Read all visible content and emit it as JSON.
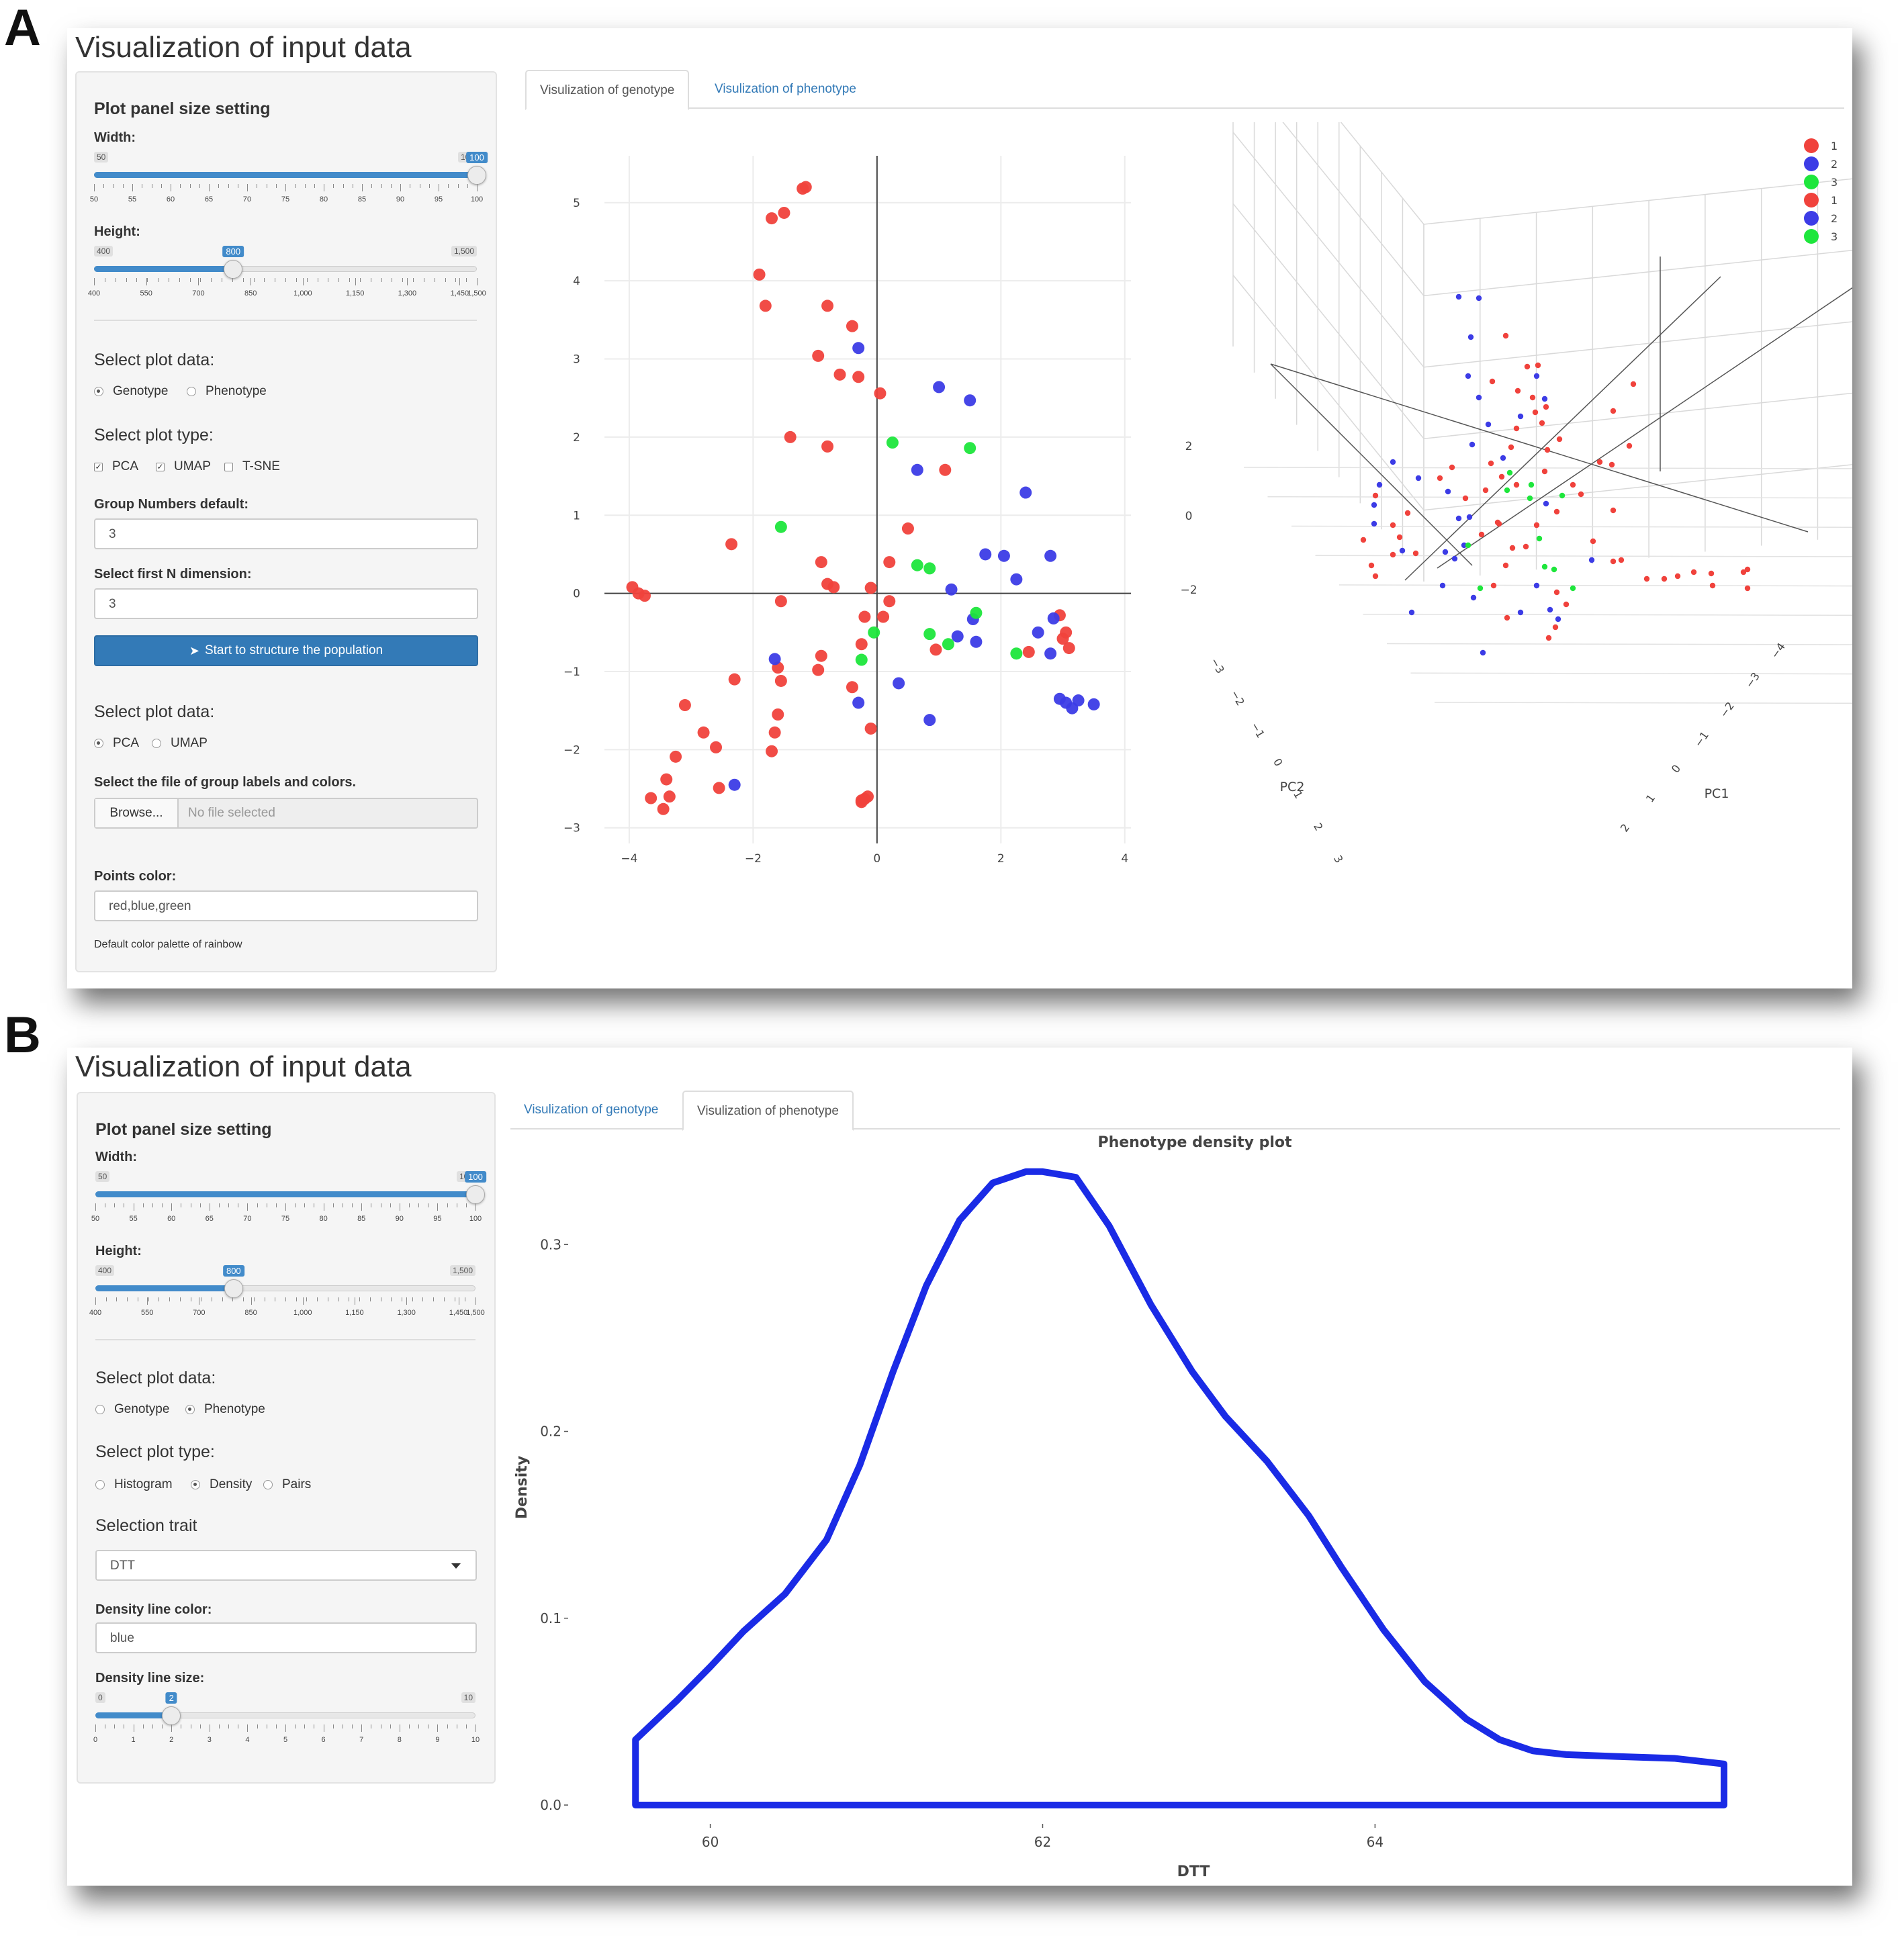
{
  "panel_labels": [
    "A",
    "B"
  ],
  "panel_a": {
    "app_title": "Visualization of input data",
    "sidebar": {
      "section_title": "Plot panel size setting",
      "width_label": "Width:",
      "width_slider": {
        "min": 50,
        "max": 100,
        "value": 100,
        "min_label": "50",
        "max_label": "100",
        "value_label": "100",
        "ticks": [
          "50",
          "55",
          "60",
          "65",
          "70",
          "75",
          "80",
          "85",
          "90",
          "95",
          "100"
        ]
      },
      "height_label": "Height:",
      "height_slider": {
        "min": 400,
        "max": 1500,
        "value": 800,
        "min_label": "400",
        "max_label": "1,500",
        "value_label": "800",
        "ticks": [
          "400",
          "550",
          "700",
          "850",
          "1,000",
          "1,150",
          "1,300",
          "1,450",
          "1,500"
        ]
      },
      "select_plot_data_title": "Select plot data:",
      "plot_data_options": [
        {
          "label": "Genotype",
          "selected": true
        },
        {
          "label": "Phenotype",
          "selected": false
        }
      ],
      "select_plot_type_title": "Select plot type:",
      "plot_type_options": [
        {
          "label": "PCA",
          "checked": true
        },
        {
          "label": "UMAP",
          "checked": true
        },
        {
          "label": "T-SNE",
          "checked": false
        }
      ],
      "group_numbers_label": "Group Numbers default:",
      "group_numbers_value": "3",
      "first_n_dim_label": "Select first N dimension:",
      "first_n_dim_value": "3",
      "start_button_label": "Start to structure the population",
      "select_plot_data_title_2": "Select plot data:",
      "plot_data_options_2": [
        {
          "label": "PCA",
          "selected": true
        },
        {
          "label": "UMAP",
          "selected": false
        }
      ],
      "group_file_label": "Select the file of group labels and colors.",
      "browse_label": "Browse...",
      "file_placeholder": "No file selected",
      "points_color_label": "Points color:",
      "points_color_value": "red,blue,green",
      "palette_note": "Default color palette of rainbow"
    },
    "tabs": [
      {
        "label": "Visulization of genotype",
        "active": true
      },
      {
        "label": "Visulization of phenotype",
        "active": false
      }
    ],
    "legend": {
      "entries": [
        "1",
        "2",
        "3",
        "1",
        "2",
        "3"
      ],
      "colors": [
        "#f0423c",
        "#3c3ce6",
        "#1ee63c",
        "#f0423c",
        "#3c3ce6",
        "#1ee63c"
      ]
    },
    "colors": {
      "group1": "#f0423c",
      "group2": "#3c3ce6",
      "group3": "#1ee63c"
    },
    "chart_data": [
      {
        "type": "scatter",
        "title": "",
        "xlabel": "",
        "ylabel": "",
        "xlim": [
          -4.4,
          4.1
        ],
        "ylim": [
          -3.2,
          5.6
        ],
        "xticks": [
          -4,
          -2,
          0,
          2,
          4
        ],
        "yticks": [
          -3,
          -2,
          -1,
          0,
          1,
          2,
          3,
          4,
          5
        ],
        "grid": true,
        "series": [
          {
            "name": "1",
            "color": "#f0423c",
            "points": [
              [
                -1.15,
                5.2
              ],
              [
                -1.2,
                5.18
              ],
              [
                -1.5,
                4.87
              ],
              [
                -1.7,
                4.8
              ],
              [
                -1.9,
                4.08
              ],
              [
                -1.8,
                3.68
              ],
              [
                -0.8,
                3.68
              ],
              [
                -0.4,
                3.42
              ],
              [
                -0.95,
                3.04
              ],
              [
                -0.6,
                2.8
              ],
              [
                -0.3,
                2.77
              ],
              [
                0.05,
                2.56
              ],
              [
                -1.4,
                2.0
              ],
              [
                -0.8,
                1.88
              ],
              [
                1.1,
                1.58
              ],
              [
                0.5,
                0.83
              ],
              [
                -2.35,
                0.63
              ],
              [
                -0.9,
                0.4
              ],
              [
                -0.8,
                0.12
              ],
              [
                -0.7,
                0.08
              ],
              [
                -0.1,
                0.07
              ],
              [
                0.2,
                0.4
              ],
              [
                0.2,
                -0.1
              ],
              [
                -3.95,
                0.08
              ],
              [
                -3.85,
                0.0
              ],
              [
                -3.75,
                -0.03
              ],
              [
                -1.55,
                -0.1
              ],
              [
                -0.2,
                -0.3
              ],
              [
                0.1,
                -0.3
              ],
              [
                -0.25,
                -0.65
              ],
              [
                -0.9,
                -0.8
              ],
              [
                -0.95,
                -0.98
              ],
              [
                -1.6,
                -0.95
              ],
              [
                -1.55,
                -1.12
              ],
              [
                -0.4,
                -1.2
              ],
              [
                -2.3,
                -1.1
              ],
              [
                -3.1,
                -1.43
              ],
              [
                -1.6,
                -1.55
              ],
              [
                -0.1,
                -1.73
              ],
              [
                -2.8,
                -1.78
              ],
              [
                -1.65,
                -1.78
              ],
              [
                -2.6,
                -1.97
              ],
              [
                -1.7,
                -2.02
              ],
              [
                -3.25,
                -2.09
              ],
              [
                -2.55,
                -2.49
              ],
              [
                -3.4,
                -2.38
              ],
              [
                -3.65,
                -2.62
              ],
              [
                -3.35,
                -2.6
              ],
              [
                -3.45,
                -2.76
              ],
              [
                -0.15,
                -2.6
              ],
              [
                -0.2,
                -2.63
              ],
              [
                -0.25,
                -2.65
              ],
              [
                -0.25,
                -2.67
              ],
              [
                0.95,
                -0.72
              ],
              [
                2.45,
                -0.75
              ],
              [
                3.0,
                -0.58
              ],
              [
                2.95,
                -0.28
              ],
              [
                3.05,
                -0.5
              ],
              [
                3.1,
                -0.7
              ]
            ]
          },
          {
            "name": "2",
            "color": "#3c3ce6",
            "points": [
              [
                -0.3,
                3.14
              ],
              [
                1.0,
                2.64
              ],
              [
                1.5,
                2.47
              ],
              [
                0.65,
                1.58
              ],
              [
                2.4,
                1.29
              ],
              [
                1.75,
                0.5
              ],
              [
                2.05,
                0.48
              ],
              [
                2.8,
                0.48
              ],
              [
                2.25,
                0.18
              ],
              [
                1.2,
                0.05
              ],
              [
                1.55,
                -0.33
              ],
              [
                2.85,
                -0.32
              ],
              [
                2.6,
                -0.5
              ],
              [
                1.6,
                -0.62
              ],
              [
                1.3,
                -0.55
              ],
              [
                2.8,
                -0.77
              ],
              [
                -1.65,
                -0.84
              ],
              [
                0.35,
                -1.15
              ],
              [
                -0.3,
                -1.4
              ],
              [
                2.95,
                -1.35
              ],
              [
                3.05,
                -1.4
              ],
              [
                3.25,
                -1.37
              ],
              [
                3.15,
                -1.47
              ],
              [
                3.5,
                -1.42
              ],
              [
                0.85,
                -1.62
              ],
              [
                -2.3,
                -2.45
              ]
            ]
          },
          {
            "name": "3",
            "color": "#1ee63c",
            "points": [
              [
                0.25,
                1.93
              ],
              [
                1.5,
                1.86
              ],
              [
                -1.55,
                0.85
              ],
              [
                0.65,
                0.36
              ],
              [
                0.85,
                0.32
              ],
              [
                1.6,
                -0.25
              ],
              [
                -0.05,
                -0.5
              ],
              [
                0.85,
                -0.52
              ],
              [
                1.15,
                -0.65
              ],
              [
                -0.25,
                -0.85
              ],
              [
                2.25,
                -0.77
              ]
            ]
          }
        ]
      },
      {
        "type": "scatter",
        "title": "",
        "xlabel": "PC1",
        "ylabel": "PC2",
        "zlabel": "",
        "projection": "3d",
        "pc1_ticks": [
          "-4",
          "-3",
          "-2",
          "-1",
          "0",
          "1",
          "2"
        ],
        "pc2_ticks": [
          "-3",
          "-2",
          "-1",
          "0",
          "1",
          "2",
          "3",
          "4"
        ],
        "z_ticks": [
          "2",
          "0",
          "-2"
        ],
        "series": [
          {
            "name": "1",
            "color": "#f0423c",
            "screen_points": "see script"
          },
          {
            "name": "2",
            "color": "#3c3ce6",
            "screen_points": "see script"
          },
          {
            "name": "3",
            "color": "#1ee63c",
            "screen_points": "see script"
          }
        ]
      }
    ]
  },
  "panel_b": {
    "app_title": "Visualization of input data",
    "sidebar": {
      "section_title": "Plot panel size setting",
      "width_label": "Width:",
      "width_slider": {
        "min": 50,
        "max": 100,
        "value": 100,
        "min_label": "50",
        "max_label": "100",
        "value_label": "100",
        "ticks": [
          "50",
          "55",
          "60",
          "65",
          "70",
          "75",
          "80",
          "85",
          "90",
          "95",
          "100"
        ]
      },
      "height_label": "Height:",
      "height_slider": {
        "min": 400,
        "max": 1500,
        "value": 800,
        "min_label": "400",
        "max_label": "1,500",
        "value_label": "800",
        "ticks": [
          "400",
          "550",
          "700",
          "850",
          "1,000",
          "1,150",
          "1,300",
          "1,450",
          "1,500"
        ]
      },
      "select_plot_data_title": "Select plot data:",
      "plot_data_options": [
        {
          "label": "Genotype",
          "selected": false
        },
        {
          "label": "Phenotype",
          "selected": true
        }
      ],
      "select_plot_type_title": "Select plot type:",
      "plot_type_options": [
        {
          "label": "Histogram",
          "selected": false
        },
        {
          "label": "Density",
          "selected": true
        },
        {
          "label": "Pairs",
          "selected": false
        }
      ],
      "selection_trait_title": "Selection trait",
      "selection_trait_value": "DTT",
      "density_color_label": "Density line color:",
      "density_color_value": "blue",
      "density_size_label": "Density line size:",
      "density_size_slider": {
        "min": 0,
        "max": 10,
        "value": 2,
        "min_label": "0",
        "max_label": "10",
        "value_label": "2",
        "ticks": [
          "0",
          "1",
          "2",
          "3",
          "4",
          "5",
          "6",
          "7",
          "8",
          "9",
          "10"
        ]
      }
    },
    "tabs": [
      {
        "label": "Visulization of genotype",
        "active": false
      },
      {
        "label": "Visulization of phenotype",
        "active": true
      }
    ],
    "line_color": "#1a2be6",
    "chart_data": {
      "type": "area",
      "title": "Phenotype density plot",
      "xlabel": "DTT",
      "ylabel": "Density",
      "xlim": [
        59.25,
        66.5
      ],
      "ylim": [
        0.0,
        0.34
      ],
      "xticks": [
        "60",
        "62",
        "64"
      ],
      "yticks": [
        "0.0",
        "0.1",
        "0.2",
        "0.3"
      ],
      "x": [
        59.55,
        59.8,
        60.0,
        60.2,
        60.45,
        60.7,
        60.9,
        61.1,
        61.3,
        61.5,
        61.7,
        61.9,
        62.0,
        62.2,
        62.4,
        62.65,
        62.9,
        63.1,
        63.35,
        63.6,
        63.8,
        64.05,
        64.3,
        64.55,
        64.75,
        64.95,
        65.15,
        65.45,
        65.8,
        66.1
      ],
      "values": [
        0.035,
        0.056,
        0.074,
        0.093,
        0.113,
        0.142,
        0.182,
        0.232,
        0.278,
        0.313,
        0.333,
        0.339,
        0.339,
        0.336,
        0.31,
        0.268,
        0.232,
        0.208,
        0.184,
        0.155,
        0.127,
        0.094,
        0.066,
        0.046,
        0.035,
        0.029,
        0.027,
        0.026,
        0.025,
        0.022
      ],
      "grid": false
    }
  }
}
